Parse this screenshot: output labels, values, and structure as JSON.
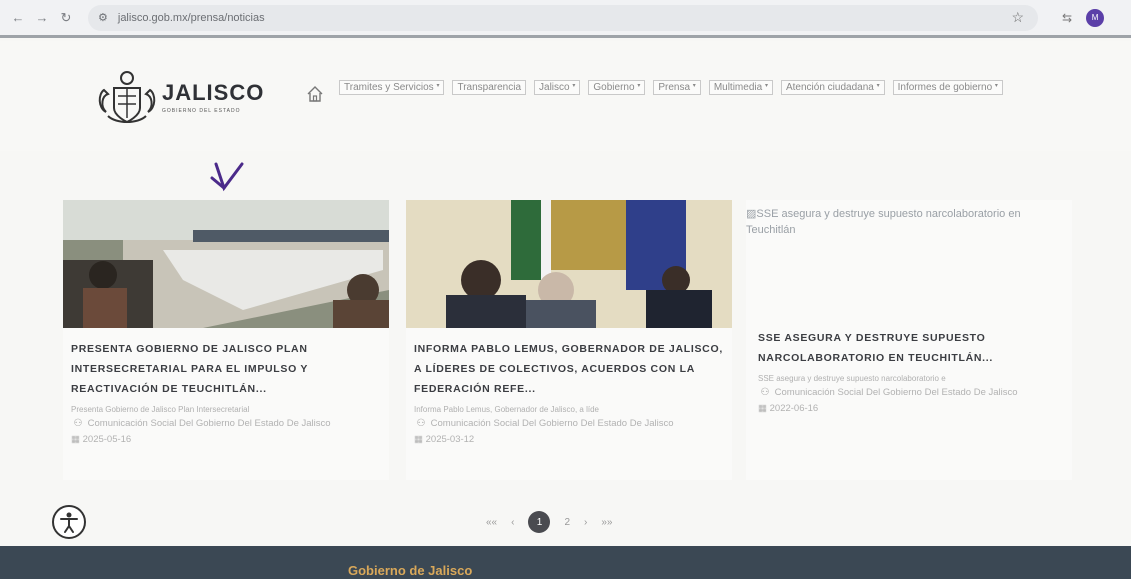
{
  "browser": {
    "url": "jalisco.gob.mx/prensa/noticias",
    "avatar_initial": "M"
  },
  "header": {
    "logo_name": "JALISCO",
    "logo_sub": "GOBIERNO DEL ESTADO",
    "menu": [
      {
        "label": "Tramites y Servicios",
        "has_dropdown": true
      },
      {
        "label": "Transparencia",
        "has_dropdown": false
      },
      {
        "label": "Jalisco",
        "has_dropdown": true
      },
      {
        "label": "Gobierno",
        "has_dropdown": true
      },
      {
        "label": "Prensa",
        "has_dropdown": true
      },
      {
        "label": "Multimedia",
        "has_dropdown": true
      },
      {
        "label": "Atención ciudadana",
        "has_dropdown": true
      },
      {
        "label": "Informes de gobierno",
        "has_dropdown": true
      }
    ]
  },
  "news": [
    {
      "title": "PRESENTA GOBIERNO DE JALISCO PLAN INTERSECRETARIAL PARA EL IMPULSO Y REACTIVACIÓN DE TEUCHITLÁN...",
      "summary": "Presenta Gobierno de Jalisco Plan Intersecretarial",
      "author": "Comunicación Social Del Gobierno Del Estado De Jalisco",
      "date": "2025-05-16",
      "image_broken": false
    },
    {
      "title": "INFORMA PABLO LEMUS, GOBERNADOR DE JALISCO, A LÍDERES DE COLECTIVOS, ACUERDOS CON LA FEDERACIÓN REFE...",
      "summary": "Informa Pablo Lemus, Gobernador de Jalisco, a líde",
      "author": "Comunicación Social Del Gobierno Del Estado De Jalisco",
      "date": "2025-03-12",
      "image_broken": false
    },
    {
      "title": "SSE ASEGURA Y DESTRUYE SUPUESTO NARCOLABORATORIO EN TEUCHITLÁN...",
      "summary": "SSE asegura y destruye supuesto narcolaboratorio e",
      "author": "Comunicación Social Del Gobierno Del Estado De Jalisco",
      "date": "2022-06-16",
      "image_broken": true,
      "image_alt": "SSE asegura y destruye supuesto narcolaboratorio en Teuchitlán"
    }
  ],
  "pagination": {
    "first": "««",
    "prev": "‹",
    "pages": [
      "1",
      "2"
    ],
    "current": "1",
    "next": "›",
    "last": "»»"
  },
  "footer": {
    "title": "Gobierno de Jalisco"
  },
  "colors": {
    "footer_bg": "#3b4854",
    "footer_title": "#d9a85a",
    "active_page": "#4a4b50",
    "annotation_arrow": "#4b2a8a"
  }
}
